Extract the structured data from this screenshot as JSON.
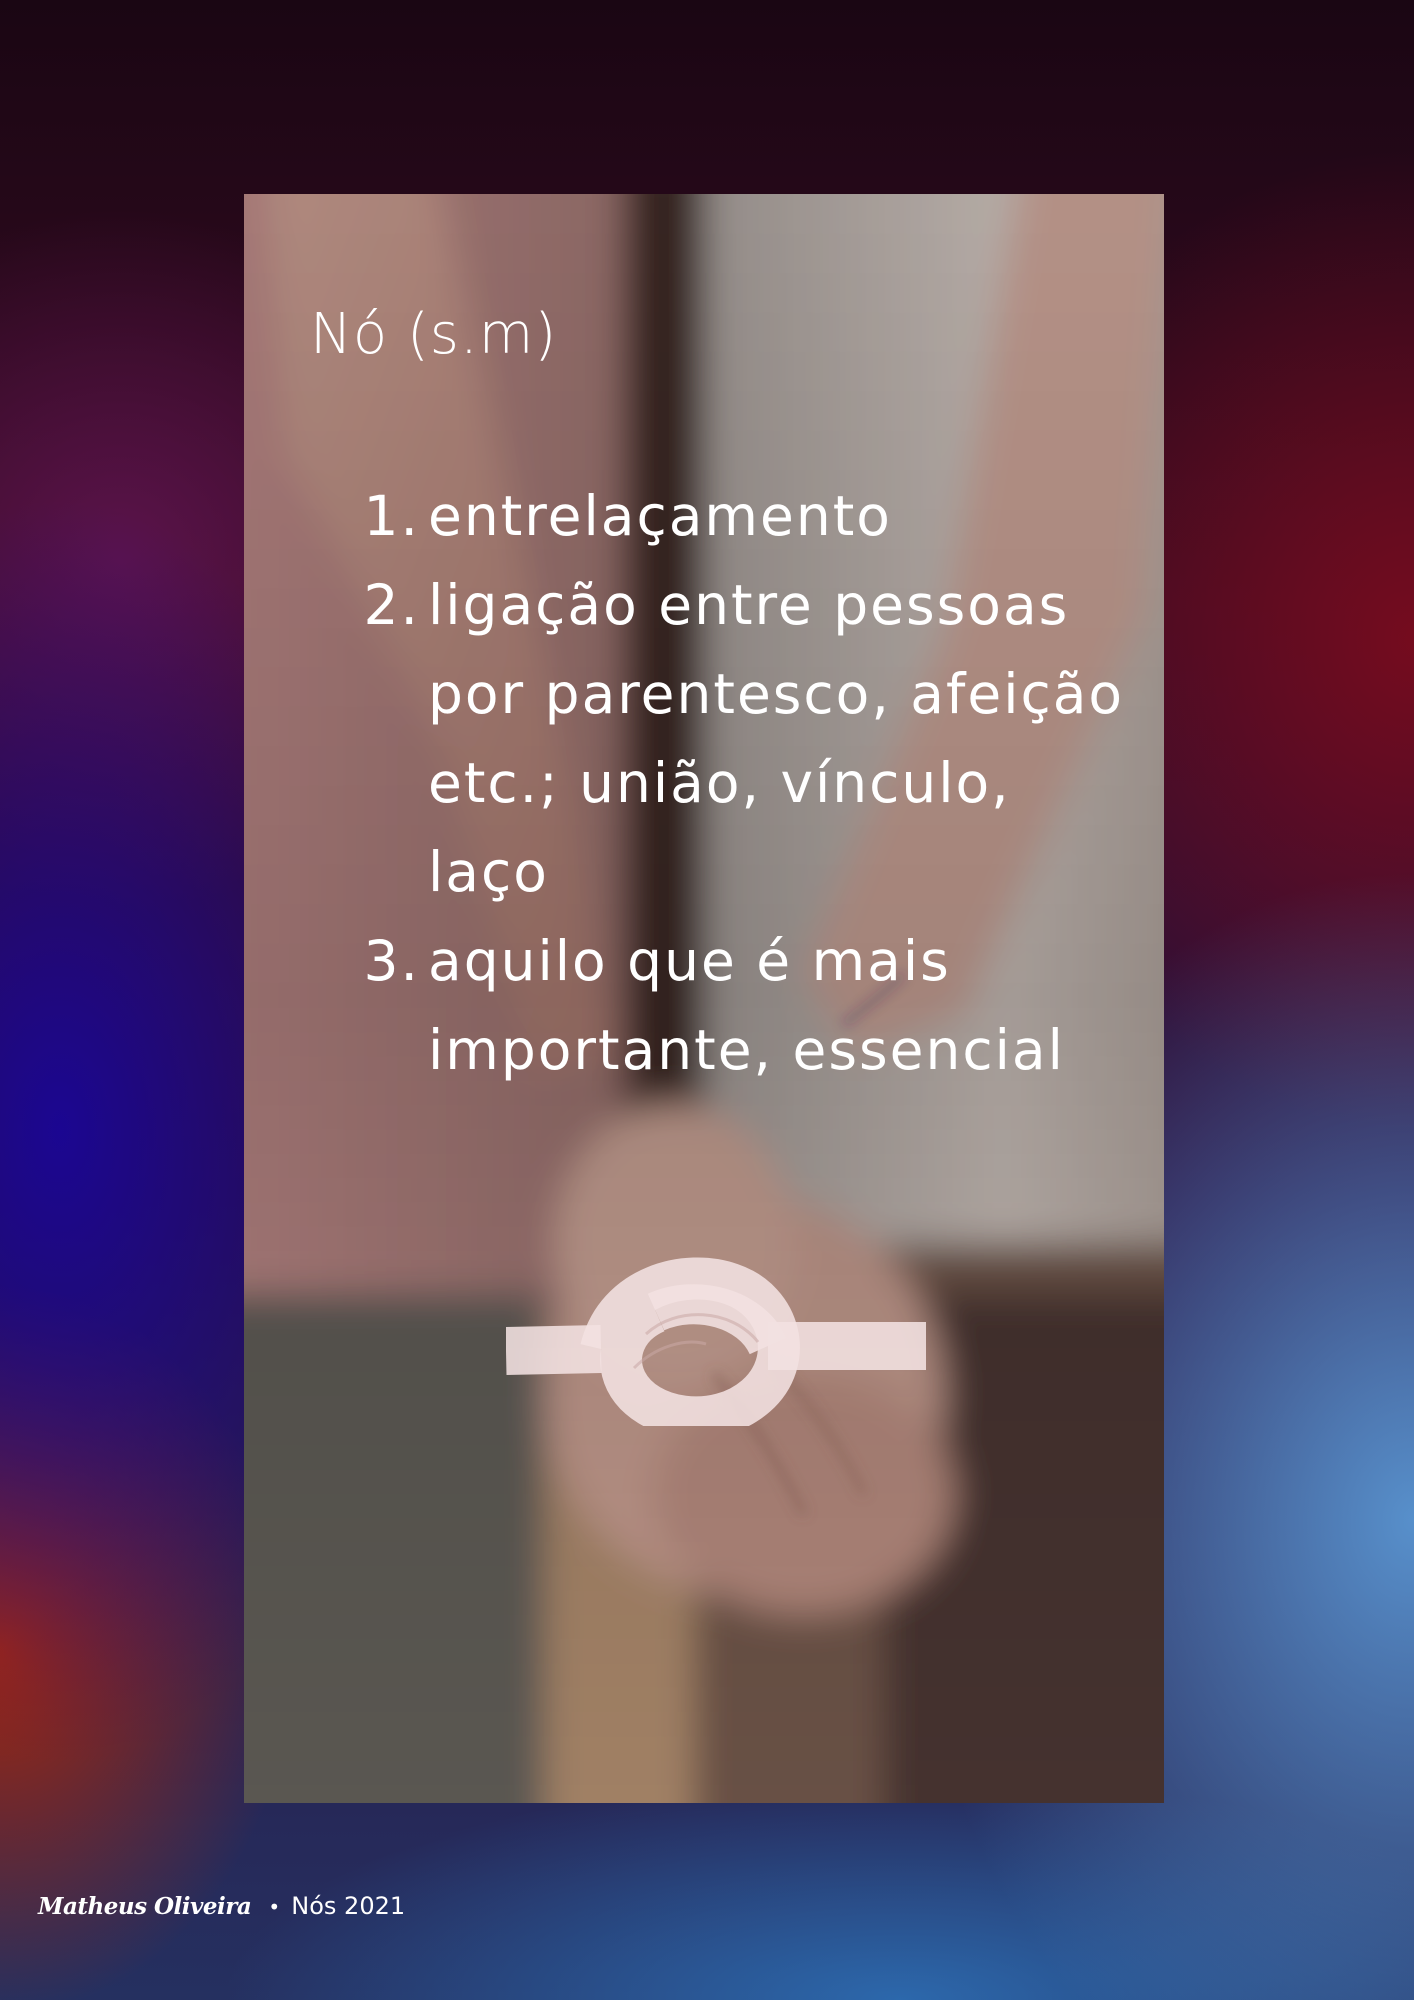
{
  "definition": {
    "title": "Nó (s.m)",
    "items": [
      {
        "number": "1.",
        "text": "entrelaçamento"
      },
      {
        "number": "2.",
        "text": "ligação entre pessoas por parentesco, afeição etc.; união, vínculo, laço"
      },
      {
        "number": "3.",
        "text": "aquilo que é mais importante, essencial"
      }
    ]
  },
  "icons": {
    "knot": "knot-icon"
  },
  "footer": {
    "author": "Matheus Oliveira",
    "separator": "•",
    "work": "Nós 2021"
  },
  "colors": {
    "text": "#ffffff",
    "knot_fill": "#efdcdc"
  }
}
